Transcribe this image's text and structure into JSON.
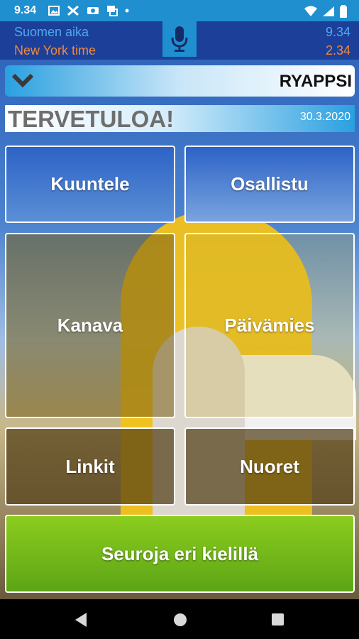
{
  "status_bar": {
    "time": "9.34",
    "icons": [
      "image-icon",
      "tools-icon",
      "vpn-icon",
      "translate-icon",
      "dot-icon",
      "wifi-icon",
      "signal-icon",
      "battery-icon"
    ]
  },
  "clocks": {
    "local_label": "Suomen aika",
    "local_time": "9.34",
    "remote_label": "New York time",
    "remote_time": "2.34"
  },
  "header": {
    "app_name": "RYAPPSI"
  },
  "welcome": {
    "text": "TERVETULOA!",
    "date": "30.3.2020"
  },
  "tiles": {
    "kuuntele": "Kuuntele",
    "osallistu": "Osallistu",
    "kanava": "Kanava",
    "paivamies": "Päivämies",
    "linkit": "Linkit",
    "nuoret": "Nuoret",
    "seuroja": "Seuroja eri kielillä"
  },
  "colors": {
    "time_bar": "#1c3f99",
    "accent": "#1f8fd0",
    "finnish_time": "#4ea9f0",
    "ny_time": "#f08a3a",
    "green_button": "#74bb1a"
  }
}
